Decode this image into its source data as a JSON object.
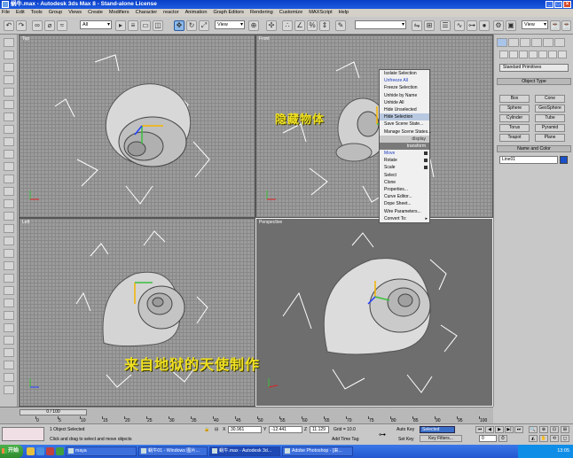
{
  "window": {
    "title": "蜗牛.max - Autodesk 3ds Max 8 - Stand-alone License"
  },
  "menu": [
    "File",
    "Edit",
    "Tools",
    "Group",
    "Views",
    "Create",
    "Modifiers",
    "Character",
    "reactor",
    "Animation",
    "Graph Editors",
    "Rendering",
    "Customize",
    "MAXScript",
    "Help"
  ],
  "toolbar": {
    "filter_value": "All",
    "refcoord_value": "View",
    "named_sel_value": "",
    "render_type_value": "View"
  },
  "viewports": {
    "top": "Top",
    "front": "Front",
    "left": "Left",
    "perspective": "Perspective"
  },
  "captions": {
    "hide_label": "隐藏物体",
    "credit": "来自地狱的天使制作"
  },
  "context_menu": {
    "display_header": "display",
    "transform_header": "transform",
    "items_display": [
      "Isolate Selection",
      "Unfreeze All",
      "Freeze Selection",
      "Unhide by Name",
      "Unhide All",
      "Hide Unselected",
      "Hide Selection",
      "Save Scene State...",
      "Manage Scene States..."
    ],
    "items_transform": [
      "Move",
      "Rotate",
      "Scale",
      "Select",
      "Clone",
      "Properties...",
      "Curve Editor...",
      "Dope Sheet...",
      "Wire Parameters...",
      "Convert To:"
    ]
  },
  "command_panel": {
    "category": "Standard Primitives",
    "object_type_label": "Object Type",
    "buttons": [
      "Box",
      "Cone",
      "Sphere",
      "GeoSphere",
      "Cylinder",
      "Tube",
      "Torus",
      "Pyramid",
      "Teapot",
      "Plane"
    ],
    "name_color_label": "Name and Color",
    "name_value": "Line01",
    "object_color": "#1a50c8"
  },
  "timeline": {
    "slider_text": "0 / 100",
    "ticks": [
      "0",
      "5",
      "10",
      "15",
      "20",
      "25",
      "30",
      "35",
      "40",
      "45",
      "50",
      "55",
      "60",
      "65",
      "70",
      "75",
      "80",
      "85",
      "90",
      "95",
      "100"
    ]
  },
  "status": {
    "selection": "1 Object Selected",
    "prompt": "Click and drag to select and move objects",
    "x_label": "X",
    "x_value": "30.961",
    "y_label": "Y",
    "y_value": "-12.441",
    "z_label": "Z",
    "z_value": "11.129",
    "grid": "Grid = 10.0",
    "add_time_tag": "Add Time Tag",
    "auto_key": "Auto Key",
    "set_key": "Set Key",
    "selected_value": "Selected",
    "key_filters": "Key Filters...",
    "frame_value": "0"
  },
  "taskbar": {
    "start": "开始",
    "tasks": [
      "maya",
      "蜗牛01 - Windows 图片...",
      "蜗牛.max - Autodesk 3d...",
      "Adobe Photoshop - [来..."
    ],
    "active_task_index": 2,
    "clock": "13:05"
  }
}
